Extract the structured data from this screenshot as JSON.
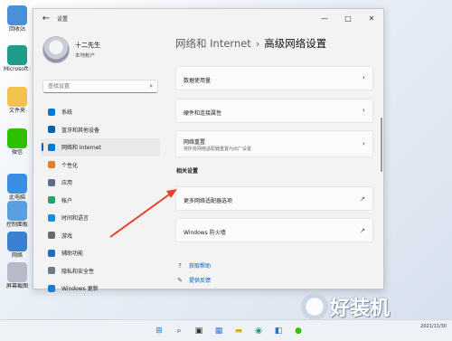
{
  "desktop": {
    "icons": [
      {
        "label": "回收站",
        "color": "#4a90d9"
      },
      {
        "label": "Microsoft Edge",
        "color": "#1f9d8b"
      },
      {
        "label": "文件夹",
        "color": "#f2c14e"
      },
      {
        "label": "微信",
        "color": "#2dc100"
      },
      {
        "label": "此电脑",
        "color": "#3a8ee6"
      },
      {
        "label": "控制面板",
        "color": "#5aa0e0"
      },
      {
        "label": "网络",
        "color": "#3d7fd1"
      },
      {
        "label": "屏幕截图",
        "color": "#b9b9c9"
      }
    ]
  },
  "window": {
    "app_title": "设置",
    "back_icon": "arrow-left-icon",
    "controls": {
      "minimize": "—",
      "maximize": "□",
      "close": "✕"
    }
  },
  "profile": {
    "name": "十二先生",
    "account_type": "本地帐户"
  },
  "search": {
    "placeholder": "查找设置",
    "icon": "search-icon"
  },
  "nav": {
    "items": [
      {
        "label": "系统",
        "color": "#0078d4",
        "icon": "monitor-icon"
      },
      {
        "label": "蓝牙和其他设备",
        "color": "#0063b1",
        "icon": "bluetooth-icon"
      },
      {
        "label": "网络和 Internet",
        "color": "#0078d4",
        "icon": "wifi-icon"
      },
      {
        "label": "个性化",
        "color": "#e27d2a",
        "icon": "brush-icon"
      },
      {
        "label": "应用",
        "color": "#5c6f84",
        "icon": "apps-icon"
      },
      {
        "label": "帐户",
        "color": "#2f9e6e",
        "icon": "account-icon"
      },
      {
        "label": "时间和语言",
        "color": "#1a8fd8",
        "icon": "clock-globe-icon"
      },
      {
        "label": "游戏",
        "color": "#6a6a6a",
        "icon": "gamepad-icon"
      },
      {
        "label": "辅助功能",
        "color": "#1b6ec2",
        "icon": "accessibility-icon"
      },
      {
        "label": "隐私和安全性",
        "color": "#6d7b8a",
        "icon": "shield-icon"
      },
      {
        "label": "Windows 更新",
        "color": "#1a7fd4",
        "icon": "update-icon"
      }
    ],
    "active_index": 2
  },
  "main": {
    "breadcrumb_parent": "网络和 Internet",
    "breadcrumb_sep": "›",
    "breadcrumb_current": "高级网络设置",
    "cards": {
      "data_usage": "数据使用量",
      "hardware_props": "硬件和连接属性",
      "network_reset": "网络重置",
      "network_reset_sub": "将所有网络适配器重置为出厂设置"
    },
    "related_heading": "相关设置",
    "related_cards": {
      "more_adapter_options": "更多网络适配器选项",
      "firewall": "Windows 防火墙"
    },
    "links": {
      "get_help": "获取帮助",
      "feedback": "提供反馈"
    },
    "chevron": "›",
    "external_icon": "↗"
  },
  "annotation": {
    "arrow_color": "#e8412c"
  },
  "taskbar": {
    "clock_date": "2021/11/30"
  },
  "watermark": {
    "text": "好装机"
  }
}
